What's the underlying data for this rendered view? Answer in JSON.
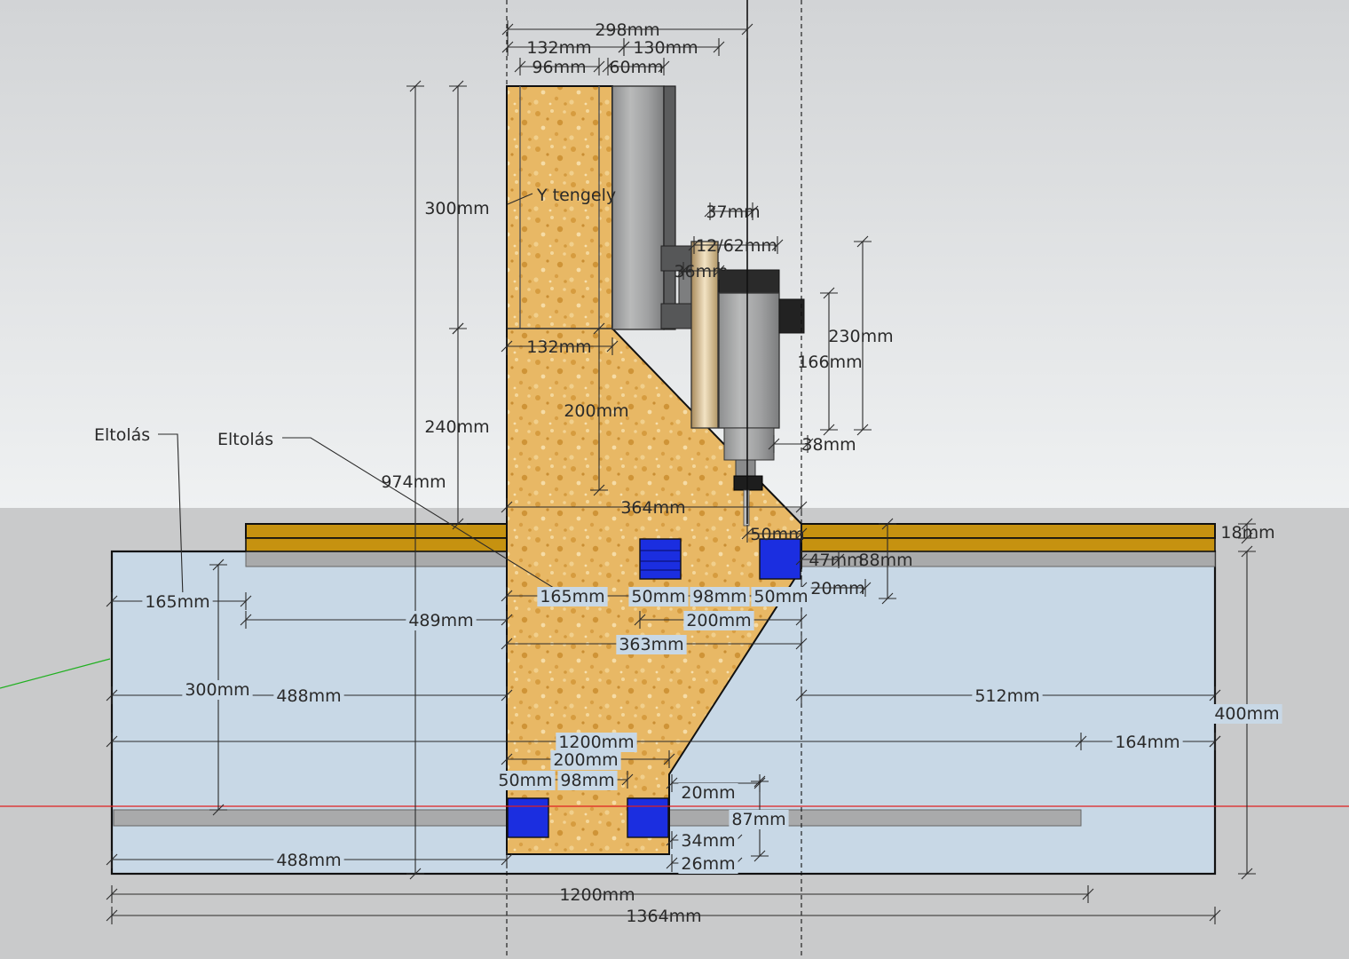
{
  "labels": {
    "y_axis": "Y tengely",
    "offset_left": "Eltolás",
    "offset_mid": "Eltolás"
  },
  "colors": {
    "sky_top": "#d4d6d8",
    "sky_bottom": "#eef0f1",
    "ground": "#c9cacb",
    "base_blue": "#c8d8e6",
    "wood": "#e6b765",
    "board": "#c79212",
    "rail_grey": "#a9aaab",
    "bearing_blue": "#1b2ee0",
    "axis_red": "#e02020",
    "axis_green": "#20b020"
  },
  "dims": {
    "d298": "298mm",
    "d132_top": "132mm",
    "d130": "130mm",
    "d96": "96mm",
    "d60": "60mm",
    "d300_col": "300mm",
    "d240": "240mm",
    "d132_mid": "132mm",
    "d200_gusset": "200mm",
    "d974": "974mm",
    "d37": "37mm",
    "d12_62": "12/62mm",
    "d36": "36mm",
    "d230": "230mm",
    "d166": "166mm",
    "d38": "38mm",
    "d364": "364mm",
    "d50_spindle": "50mm",
    "d18": "18mm",
    "d47": "47mm",
    "d88": "88mm",
    "d20_top": "20mm",
    "d165_left": "165mm",
    "d165_mid": "165mm",
    "d50_a": "50mm",
    "d98_a": "98mm",
    "d50_b": "50mm",
    "d489": "489mm",
    "d200_mid": "200mm",
    "d363": "363mm",
    "d300_left": "300mm",
    "d488_upper": "488mm",
    "d512": "512mm",
    "d400": "400mm",
    "d1200_inner": "1200mm",
    "d164": "164mm",
    "d200_bottom": "200mm",
    "d50_c": "50mm",
    "d98_b": "98mm",
    "d20_bottom": "20mm",
    "d87": "87mm",
    "d34": "34mm",
    "d26": "26mm",
    "d488_lower": "488mm",
    "d1200_outer": "1200mm",
    "d1364": "1364mm"
  }
}
